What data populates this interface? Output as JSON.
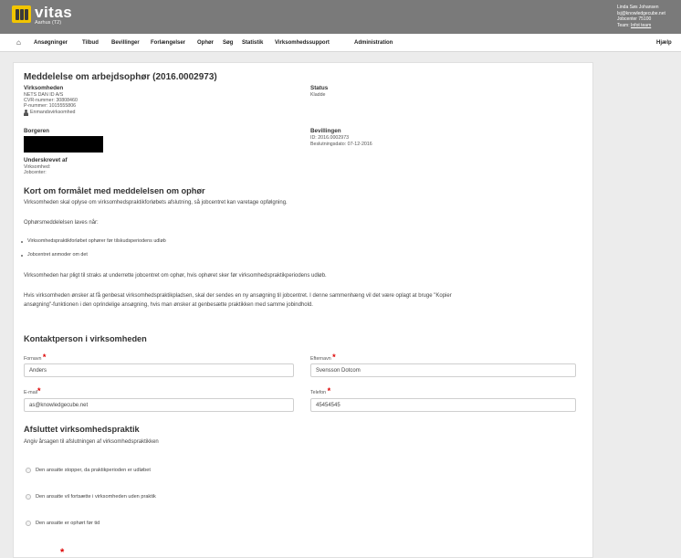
{
  "header": {
    "logo_text": "vitas",
    "logo_sub": "Aarhus (T2)",
    "user_name": "Linda Søs Johansen",
    "user_email": "lsj@knowledgecube.net",
    "jobcenter": "Jobcenter 75100",
    "team_prefix": "Team:",
    "team_link": "Infot team"
  },
  "nav": {
    "home_icon": "home-icon",
    "items": [
      "Ansøgninger",
      "Tilbud",
      "Bevillinger",
      "Forlængelser",
      "Ophør",
      "Søg",
      "Statistik",
      "Virksomhedssupport",
      "Administration"
    ],
    "help": "Hjælp"
  },
  "page": {
    "title": "Meddelelse om arbejdsophør (2016.0002973)",
    "company": {
      "heading": "Virksomheden",
      "name": "NETS DAN ID A/S",
      "cvr": "CVR-nummer: 30808460",
      "p_number": "P-nummer: 1015555806",
      "type": "Enmandsvirksomhed"
    },
    "status": {
      "heading": "Status",
      "value": "Kladde"
    },
    "citizen": {
      "heading": "Borgeren"
    },
    "grant": {
      "heading": "Bevillingen",
      "id": "ID: 2016.0002973",
      "decision_date": "Beslutningsdato: 07-12-2016"
    },
    "signed": {
      "heading": "Underskrevet af",
      "company": "Virksomhed:",
      "jobcenter": "Jobcenter:"
    }
  },
  "purpose": {
    "heading": "Kort om formålet med meddelelsen om ophør",
    "p1": "Virksomheden skal oplyse om virksomhedspraktikforløbets afslutning, så jobcentret kan varetage opfølgning.",
    "p2": "Ophørsmeddelelsen laves når:",
    "bullets": [
      "Virksomhedspraktikforløbet ophører før tilskudsperiodens udløb",
      "Jobcentret anmoder om det"
    ],
    "p3": "Virksomheden har pligt til straks at underrette jobcentret om ophør, hvis ophøret sker før virksomhedspraktikperiodens udløb.",
    "p4a": "Hvis virksomheden ønsker at få genbesat virksomhedspraktikpladsen, skal der sendes en ny ansøgning til jobcentret. I denne sammenhæng vil det være oplagt at bruge \"Kopier",
    "p4b": "ansøgning\"-funktionen i den oprindelige ansøgning, hvis man ønsker at genbesætte praktikken med samme jobindhold."
  },
  "contact": {
    "heading": "Kontaktperson i virksomheden",
    "required_mark": "*",
    "first_name_label": "Fornavn",
    "first_name_value": "Anders",
    "last_name_label": "Efternavn",
    "last_name_value": "Svensson Dotcom",
    "email_label": "E-mail",
    "email_value": "as@knowledgecube.net",
    "phone_label": "Telefon",
    "phone_value": "45454545"
  },
  "ended": {
    "heading": "Afsluttet virksomhedspraktik",
    "intro": "Angiv årsagen til afslutningen af virksomhedspraktikken",
    "options": [
      "Den ansatte stopper, da praktikperioden er udløbet",
      "Den ansatte vil fortsætte i virksomheden uden praktik",
      "Den ansatte er ophørt før tid"
    ]
  },
  "colors": {
    "header_bg": "#7a7a7a",
    "logo_yellow": "#f2c500",
    "required": "#dd0000",
    "page_bg": "#ececec"
  }
}
